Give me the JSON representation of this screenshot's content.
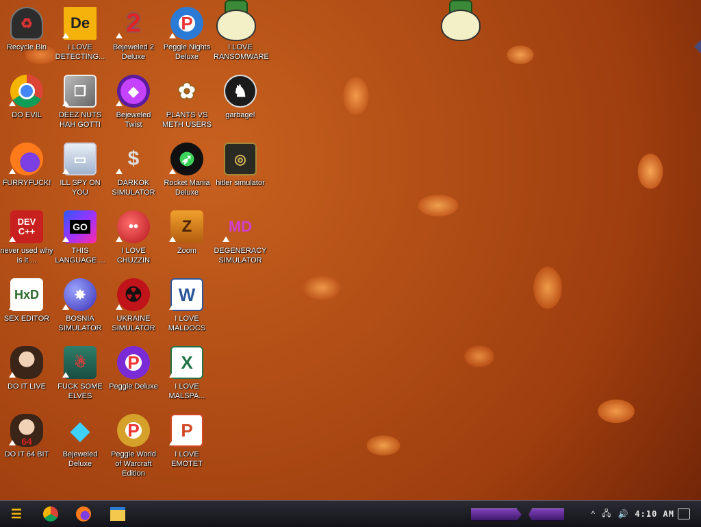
{
  "desktop": {
    "icons": [
      {
        "label": "Recycle Bin",
        "icon": "recycle-bin-icon"
      },
      {
        "label": "I LOVE DETECTING...",
        "icon": "detect-icon"
      },
      {
        "label": "Bejeweled 2 Deluxe",
        "icon": "bejeweled2-icon"
      },
      {
        "label": "Peggle Nights Deluxe",
        "icon": "peggle-icon"
      },
      {
        "label": "I LOVE RANSOMWARE",
        "icon": "money-bag-icon"
      },
      {
        "label": "DO EVIL",
        "icon": "chrome-icon"
      },
      {
        "label": "DEEZ NUTS HAH GOTTI",
        "icon": "window-stack-icon"
      },
      {
        "label": "Bejeweled Twist",
        "icon": "gem-icon"
      },
      {
        "label": "PLANTS VS METH USERS",
        "icon": "plant-icon"
      },
      {
        "label": "garbage!",
        "icon": "lion-icon"
      },
      {
        "label": "FURRYFUCK!",
        "icon": "firefox-icon"
      },
      {
        "label": "ILL SPY ON YOU",
        "icon": "monitor-icon"
      },
      {
        "label": "DARKOK SIMULATOR",
        "icon": "money-bag-icon"
      },
      {
        "label": "Rocket Mania Deluxe",
        "icon": "rocket-icon"
      },
      {
        "label": "hitler simulator",
        "icon": "emblem-icon"
      },
      {
        "label": "never used why is it ...",
        "icon": "devcpp-icon"
      },
      {
        "label": "THIS LANGUAGE ...",
        "icon": "go-icon"
      },
      {
        "label": "I LOVE CHUZZIN",
        "icon": "chuzzle-icon"
      },
      {
        "label": "Zoom",
        "icon": "zuma-icon"
      },
      {
        "label": "DEGENERACY SIMULATOR",
        "icon": "mmd-icon"
      },
      {
        "label": "SEX EDITOR",
        "icon": "hex-editor-icon"
      },
      {
        "label": "BOSNIA SIMULATOR",
        "icon": "mine-icon"
      },
      {
        "label": "UKRAINE SIMULATOR",
        "icon": "radiation-icon"
      },
      {
        "label": "I LOVE MALDOCS",
        "icon": "word-icon"
      },
      {
        "label": "DO IT LIVE",
        "icon": "portrait-icon"
      },
      {
        "label": "FUCK SOME ELVES",
        "icon": "santa-icon"
      },
      {
        "label": "Peggle Deluxe",
        "icon": "peggle-icon"
      },
      {
        "label": "I LOVE MALSPA...",
        "icon": "excel-icon"
      },
      {
        "label": "DO IT 64 BIT",
        "icon": "portrait-64-icon"
      },
      {
        "label": "Bejeweled Deluxe",
        "icon": "diamond-icon"
      },
      {
        "label": "Peggle World of Warcraft Edition",
        "icon": "peggle-icon"
      },
      {
        "label": "I LOVE EMOTET",
        "icon": "powerpoint-icon"
      }
    ]
  },
  "taskbar": {
    "start_icon": "start-icon",
    "pinned": [
      {
        "name": "chrome-icon",
        "glyph": "◉",
        "color": "#e04b3a"
      },
      {
        "name": "firefox-icon",
        "glyph": "◉",
        "color": "#ff7a1a"
      },
      {
        "name": "file-explorer-icon",
        "glyph": "▬",
        "color": "#f2c94c"
      }
    ],
    "clock": "4:10 AM"
  },
  "colors": {
    "accent": "#7d3fb8",
    "start": "#f6b800"
  }
}
